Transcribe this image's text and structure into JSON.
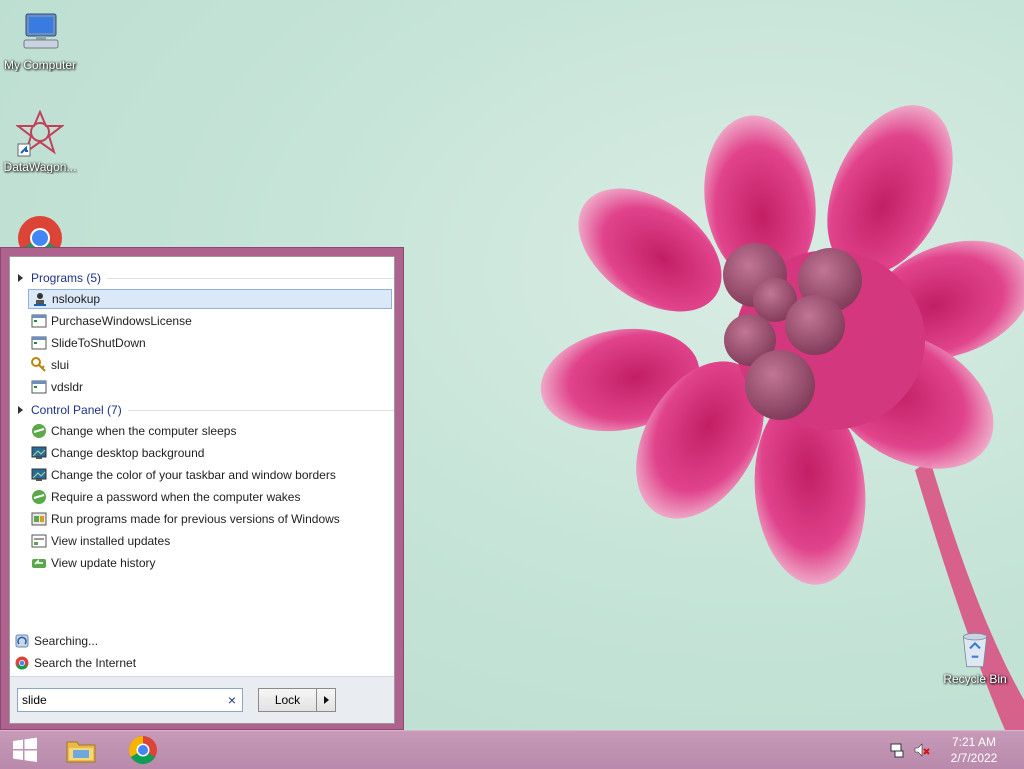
{
  "desktop": {
    "icons": [
      {
        "label": "My Computer",
        "icon": "computer-icon"
      },
      {
        "label": "DataWagon...",
        "icon": "datawagon-icon"
      },
      {
        "label": "",
        "icon": "chrome-icon"
      },
      {
        "label": "Recycle Bin",
        "icon": "recycle-bin-icon"
      }
    ]
  },
  "start_menu": {
    "programs_header": "Programs (5)",
    "programs": [
      {
        "label": "nslookup",
        "icon": "network-program-icon",
        "selected": true
      },
      {
        "label": "PurchaseWindowsLicense",
        "icon": "application-icon"
      },
      {
        "label": "SlideToShutDown",
        "icon": "application-icon"
      },
      {
        "label": "slui",
        "icon": "key-icon"
      },
      {
        "label": "vdsldr",
        "icon": "application-icon"
      }
    ],
    "control_panel_header": "Control Panel (7)",
    "control_panel": [
      {
        "label": "Change when the computer sleeps",
        "icon": "power-options-icon"
      },
      {
        "label": "Change desktop background",
        "icon": "display-icon"
      },
      {
        "label": "Change the color of your taskbar and window borders",
        "icon": "display-icon"
      },
      {
        "label": "Require a password when the computer wakes",
        "icon": "power-options-icon"
      },
      {
        "label": "Run programs made for previous versions of Windows",
        "icon": "compatibility-icon"
      },
      {
        "label": "View installed updates",
        "icon": "programs-icon"
      },
      {
        "label": "View update history",
        "icon": "windows-update-icon"
      }
    ],
    "searching_label": "Searching...",
    "search_internet_label": "Search the Internet",
    "search_value": "slide",
    "clear_label": "×",
    "lock_label": "Lock"
  },
  "taskbar": {
    "apps": [
      {
        "icon": "start-windows-icon"
      },
      {
        "icon": "file-explorer-icon"
      },
      {
        "icon": "chrome-icon"
      }
    ],
    "time": "7:21 AM",
    "date": "2/7/2022"
  },
  "colors": {
    "accent": "#b0628f",
    "taskbar": "#c79ab8",
    "link": "#1e3287"
  }
}
